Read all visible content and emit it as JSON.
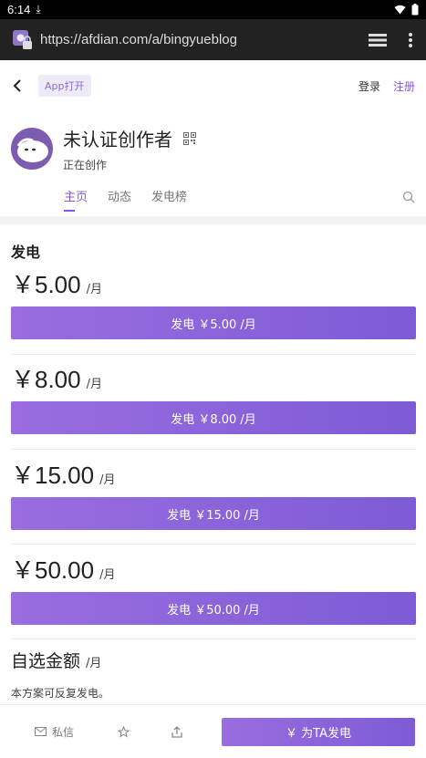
{
  "status_bar": {
    "time": "6:14"
  },
  "browser": {
    "url": "https://afdian.com/a/bingyueblog"
  },
  "header": {
    "app_open_label": "App打开",
    "login_label": "登录",
    "register_label": "注册"
  },
  "creator": {
    "name": "未认证创作者",
    "status": "正在创作"
  },
  "tabs": [
    {
      "label": "主页",
      "active": true
    },
    {
      "label": "动态",
      "active": false
    },
    {
      "label": "发电榜",
      "active": false
    }
  ],
  "section": {
    "title": "发电"
  },
  "tiers": [
    {
      "price": "￥5.00",
      "period": "/月",
      "button_label": "发电 ￥5.00 /月"
    },
    {
      "price": "￥8.00",
      "period": "/月",
      "button_label": "发电 ￥8.00 /月"
    },
    {
      "price": "￥15.00",
      "period": "/月",
      "button_label": "发电 ￥15.00 /月"
    },
    {
      "price": "￥50.00",
      "period": "/月",
      "button_label": "发电 ￥50.00 /月"
    }
  ],
  "custom": {
    "title": "自选金额",
    "period": "/月",
    "note": "本方案可反复发电。"
  },
  "bottom_bar": {
    "message_label": "私信",
    "support_label": "￥ 为TA发电"
  },
  "colors": {
    "accent": "#8a55e0",
    "button_gradient_start": "#9a6ddf",
    "button_gradient_end": "#7d5bd6"
  }
}
